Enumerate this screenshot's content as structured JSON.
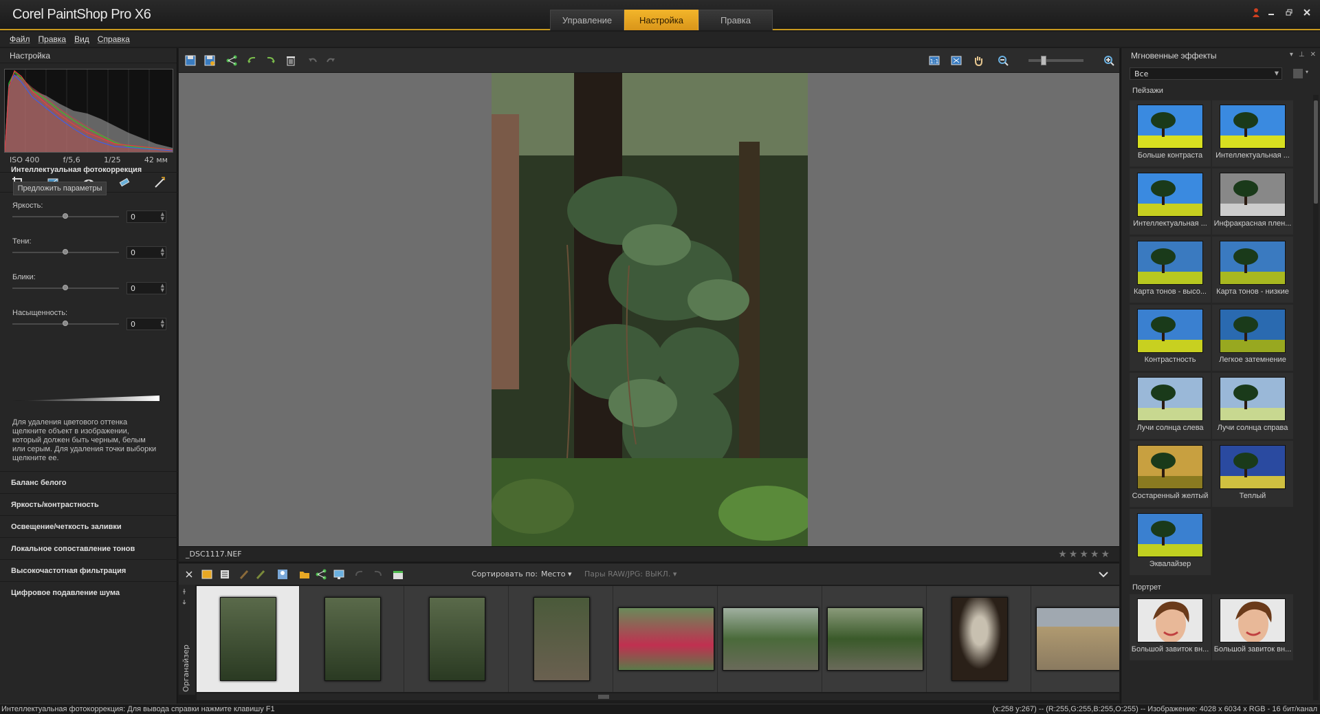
{
  "app": {
    "title": "Corel PaintShop Pro X6",
    "modes": [
      "Управление",
      "Настройка",
      "Правка"
    ],
    "active_mode": "Настройка"
  },
  "menu": [
    "Файл",
    "Правка",
    "Вид",
    "Справка"
  ],
  "left_panel": {
    "header": "Настройка",
    "exif": {
      "iso": "ISO 400",
      "aperture": "f/5,6",
      "shutter": "1/25",
      "focal": "42 мм"
    },
    "smart_fix_title": "Интеллектуальная фотокоррекция",
    "suggest_button": "Предложить параметры",
    "sliders": [
      {
        "label": "Яркость:",
        "value": "0"
      },
      {
        "label": "Тени:",
        "value": "0"
      },
      {
        "label": "Блики:",
        "value": "0"
      },
      {
        "label": "Насыщенность:",
        "value": "0"
      }
    ],
    "help_text": "Для удаления цветового оттенка щелкните объект в изображении, который должен быть черным, белым или серым. Для удаления точки выборки щелкните ее.",
    "sections": [
      "Баланс белого",
      "Яркость/контрастность",
      "Освещение/четкость заливки",
      "Локальное сопоставление тонов",
      "Высокочастотная фильтрация",
      "Цифровое подавление шума"
    ]
  },
  "image": {
    "filename": "_DSC1117.NEF",
    "rating_max": 5
  },
  "organizer": {
    "label": "Органайзер",
    "sort_label": "Сортировать по:",
    "sort_value": "Место",
    "raw_pairs": "Пары RAW/JPG: ВЫКЛ."
  },
  "right_panel": {
    "header": "Мгновенные эффекты",
    "filter": "Все",
    "categories": [
      {
        "name": "Пейзажи",
        "effects": [
          "Больше контраста",
          "Интеллектуальная ...",
          "Интеллектуальная ...",
          "Инфракрасная плен...",
          "Карта тонов - высо...",
          "Карта тонов - низкие",
          "Контрастность",
          "Легкое затемнение",
          "Лучи солнца слева",
          "Лучи солнца справа",
          "Состаренный желтый",
          "Теплый",
          "Эквалайзер"
        ]
      },
      {
        "name": "Портрет",
        "effects": [
          "Большой завиток вн...",
          "Большой завиток вн..."
        ]
      }
    ]
  },
  "status": {
    "left": "Интеллектуальная фотокоррекция: Для вывода справки нажмите клавишу F1",
    "right": "(x:258 y:267) -- (R:255,G:255,B:255,O:255) -- Изображение:  4028 x 6034 x RGB - 16 бит/канал"
  },
  "colors": {
    "accent": "#e8a824",
    "panel": "#262626",
    "canvas": "#6e6e6e"
  }
}
